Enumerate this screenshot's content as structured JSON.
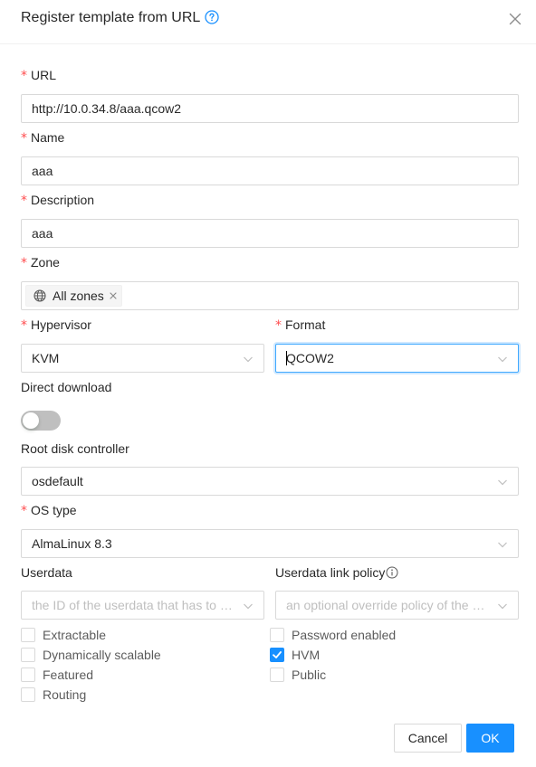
{
  "dialog": {
    "title": "Register template from URL",
    "help_icon": "question-circle-icon",
    "close_icon": "close-icon"
  },
  "form": {
    "url": {
      "label": "URL",
      "value": "http://10.0.34.8/aaa.qcow2"
    },
    "name": {
      "label": "Name",
      "value": "aaa"
    },
    "description": {
      "label": "Description",
      "value": "aaa"
    },
    "zone": {
      "label": "Zone",
      "tag": "All zones",
      "tag_icon": "globe-icon"
    },
    "hypervisor": {
      "label": "Hypervisor",
      "value": "KVM"
    },
    "format": {
      "label": "Format",
      "value": "QCOW2"
    },
    "direct_download": {
      "label": "Direct download",
      "enabled": false
    },
    "root_disk_controller": {
      "label": "Root disk controller",
      "value": "osdefault"
    },
    "os_type": {
      "label": "OS type",
      "value": "AlmaLinux 8.3"
    },
    "userdata": {
      "label": "Userdata",
      "placeholder": "the ID of the userdata that has to be linked to the template"
    },
    "userdata_link_policy": {
      "label": "Userdata link policy",
      "placeholder": "an optional override policy of the userdata"
    }
  },
  "checkboxes": [
    {
      "label": "Extractable",
      "checked": false
    },
    {
      "label": "Password enabled",
      "checked": false
    },
    {
      "label": "Dynamically scalable",
      "checked": false
    },
    {
      "label": "HVM",
      "checked": true
    },
    {
      "label": "Featured",
      "checked": false
    },
    {
      "label": "Public",
      "checked": false
    },
    {
      "label": "Routing",
      "checked": false
    }
  ],
  "buttons": {
    "cancel": "Cancel",
    "ok": "OK"
  },
  "colors": {
    "primary": "#1890ff",
    "required": "#ff4d4f",
    "border": "#d9d9d9",
    "placeholder": "#bfbfbf"
  }
}
